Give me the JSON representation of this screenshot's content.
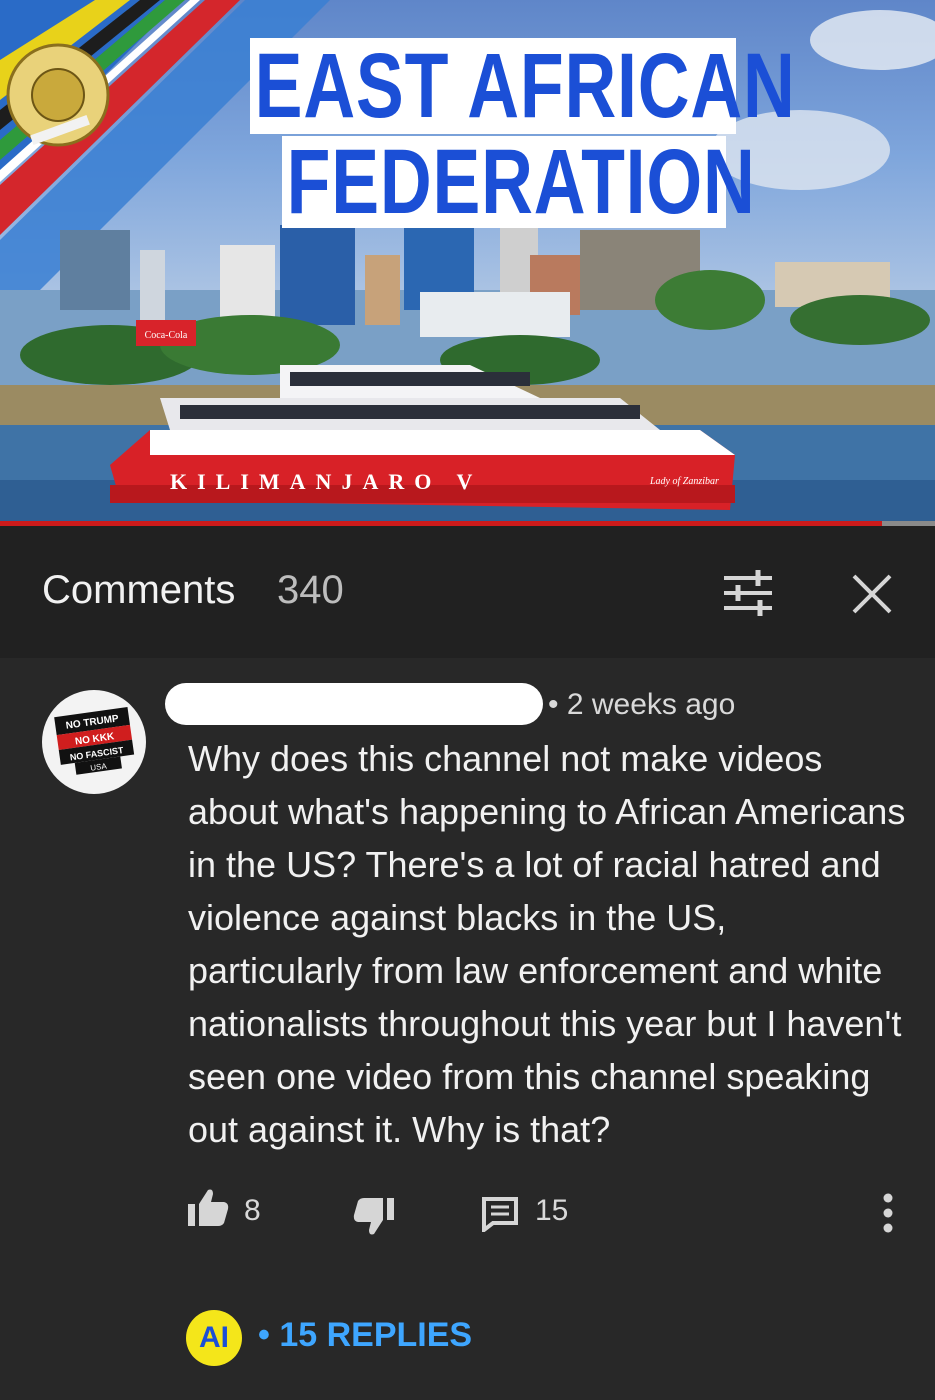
{
  "thumbnail": {
    "title_line1": "EAST AFRICAN",
    "title_line2": "FEDERATION",
    "boat_name": "KILIMANJARO V",
    "boat_tag": "Lady of Zanzibar",
    "sign_text": "Coca-Cola",
    "progress_fraction": 0.943
  },
  "comments_header": {
    "title": "Comments",
    "count": "340"
  },
  "comment": {
    "avatar_lines": [
      "NO TRUMP",
      "NO KKK",
      "NO FASCIST",
      "USA"
    ],
    "time": "2 weeks ago",
    "text": "Why does this channel not make videos about what's happening to African Americans in the US? There's a lot of racial hatred and violence against blacks in the US, particularly from law enforcement and white nationalists throughout this year but I haven't seen one video from this channel speaking out against it. Why is that?",
    "likes": "8",
    "reply_count": "15"
  },
  "replies": {
    "avatar_initials": "AI",
    "label": "15 REPLIES"
  },
  "colors": {
    "background": "#282828",
    "header_bg": "#212121",
    "title_blue": "#1b4fd6",
    "link_blue": "#3ea6ff",
    "progress_red": "#cc1b1b"
  }
}
